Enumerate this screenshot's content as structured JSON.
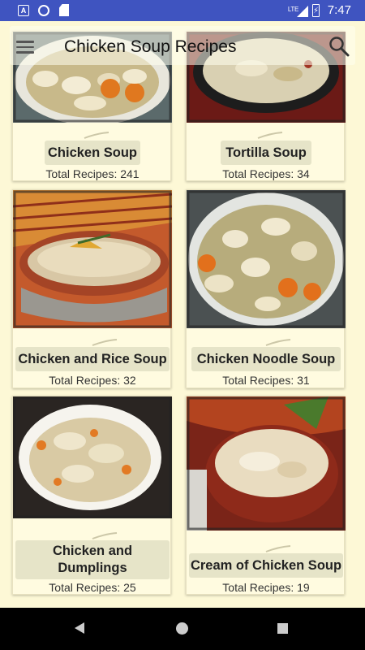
{
  "status_bar": {
    "network": "LTE",
    "time": "7:47"
  },
  "header": {
    "title": "Chicken Soup Recipes",
    "menu_icon": "hamburger-menu-icon",
    "search_icon": "search-icon"
  },
  "cards": [
    {
      "title": "Chicken Soup",
      "count": "Total Recipes: 241",
      "image": "chicken-soup-photo"
    },
    {
      "title": "Tortilla Soup",
      "count": "Total Recipes: 34",
      "image": "tortilla-soup-photo"
    },
    {
      "title": "Chicken and Rice Soup",
      "count": "Total Recipes: 32",
      "image": "chicken-rice-soup-photo"
    },
    {
      "title": "Chicken Noodle Soup",
      "count": "Total Recipes: 31",
      "image": "chicken-noodle-soup-photo"
    },
    {
      "title": "Chicken and Dumplings",
      "count": "Total Recipes: 25",
      "image": "chicken-dumplings-photo"
    },
    {
      "title": "Cream of Chicken Soup",
      "count": "Total Recipes: 19",
      "image": "cream-chicken-soup-photo"
    }
  ],
  "colors": {
    "status_bar": "#3f54c0",
    "background": "#fdf8d6",
    "card": "#fffbe0",
    "nav_bar": "#000000"
  }
}
